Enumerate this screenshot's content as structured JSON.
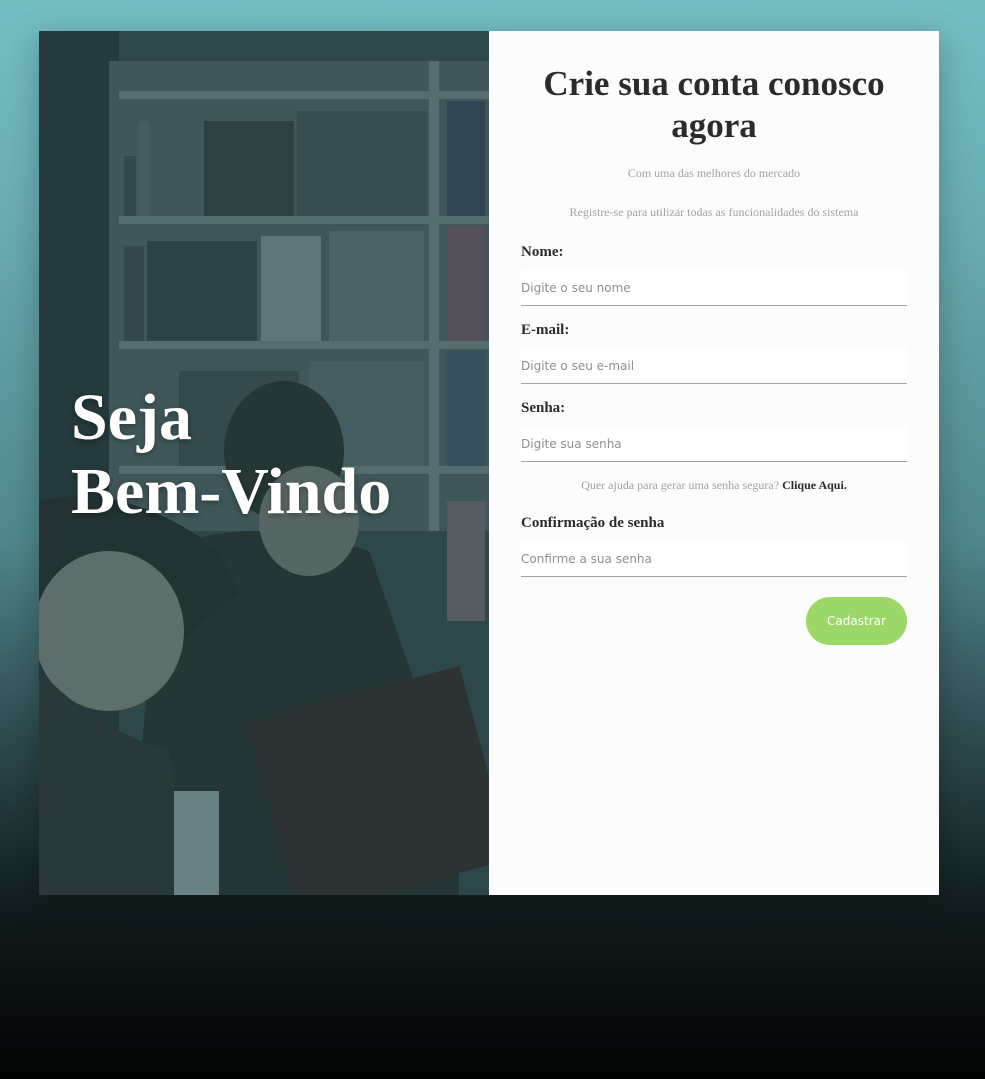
{
  "hero": {
    "title_line1": "Seja",
    "title_line2": "Bem-Vindo"
  },
  "form": {
    "title": "Crie sua conta conosco agora",
    "subtitle1": "Com uma das melhores do mercado",
    "subtitle2": "Registre-se para utilizar todas as funcionalidades do sistema",
    "fields": [
      {
        "label": "Nome:",
        "placeholder": "Digite o seu nome"
      },
      {
        "label": "E-mail:",
        "placeholder": "Digite o seu e-mail"
      },
      {
        "label": "Senha:",
        "placeholder": "Digite sua senha"
      },
      {
        "label": "Confirmação de senha",
        "placeholder": "Confirme a sua senha"
      }
    ],
    "help_text": "Quer ajuda para gerar uma senha segura?",
    "help_link": "Clique Aqui.",
    "submit_label": "Cadastrar"
  },
  "colors": {
    "accent": "#9bd868",
    "text_dark": "#2b2b2b",
    "text_muted": "#a3a3a3",
    "hero_overlay": "#2a4346"
  }
}
